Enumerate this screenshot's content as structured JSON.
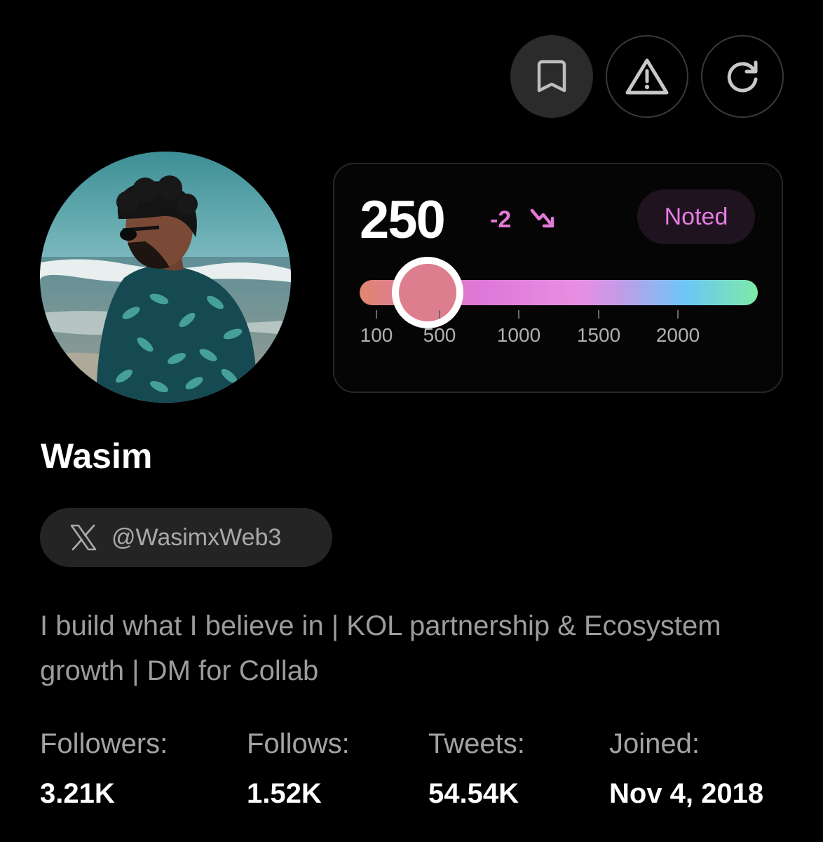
{
  "header": {
    "actions": [
      {
        "icon": "bookmark-icon"
      },
      {
        "icon": "warning-icon"
      },
      {
        "icon": "refresh-icon"
      }
    ]
  },
  "profile": {
    "name": "Wasim",
    "handle": "@WasimxWeb3",
    "handle_icon": "x-logo-icon",
    "bio": "I build what I believe in | KOL partnership & Ecosystem growth | DM for Collab"
  },
  "score": {
    "value": "250",
    "delta": "-2",
    "trend_icon": "trend-down-icon",
    "status": "Noted",
    "slider_value": 250,
    "slider_ticks": [
      "100",
      "500",
      "1000",
      "1500",
      "2000"
    ],
    "colors": {
      "delta": "#e279d6",
      "status_text": "#e67de0",
      "thumb": "#dd7e8e"
    }
  },
  "stats": [
    {
      "label": "Followers:",
      "value": "3.21K"
    },
    {
      "label": "Follows:",
      "value": "1.52K"
    },
    {
      "label": "Tweets:",
      "value": "54.54K"
    },
    {
      "label": "Joined:",
      "value": "Nov 4, 2018"
    }
  ]
}
